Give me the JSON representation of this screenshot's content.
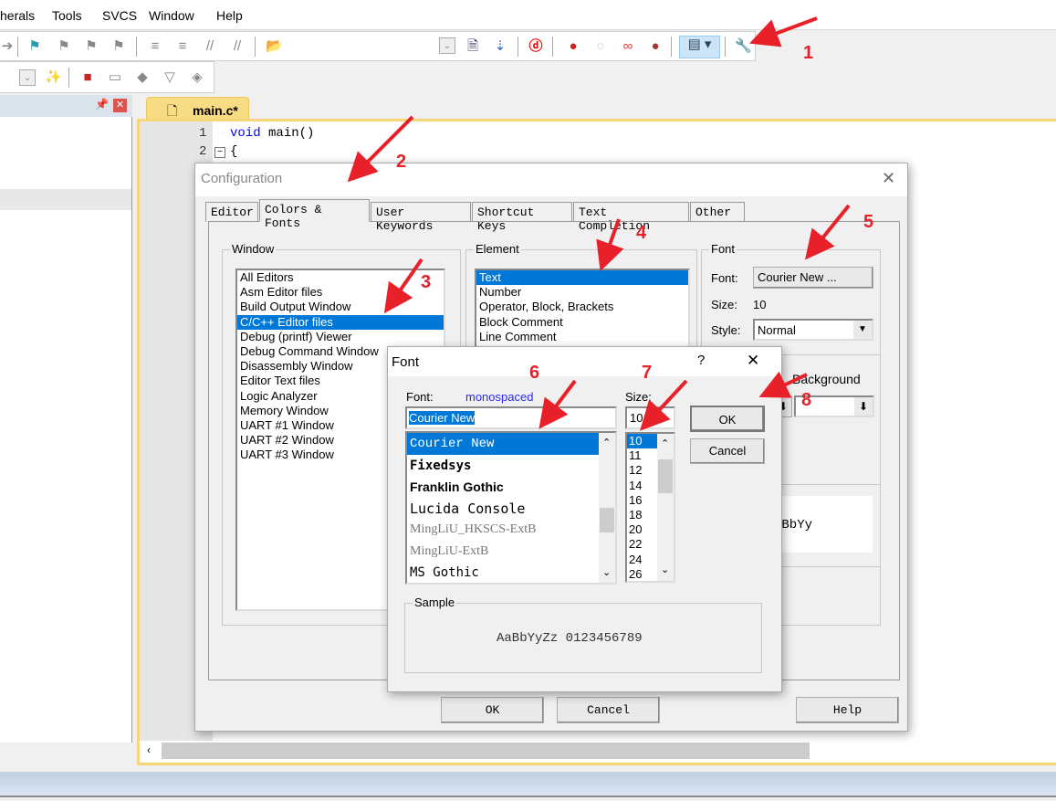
{
  "menu": [
    "herals",
    "Tools",
    "SVCS",
    "Window",
    "Help"
  ],
  "editor": {
    "tab": "main.c*",
    "lines": [
      {
        "num": "1",
        "code": "void main()",
        "keyword": "void",
        "rest": " main()"
      },
      {
        "num": "2",
        "code": "{"
      }
    ]
  },
  "config": {
    "title": "Configuration",
    "tabs": [
      "Editor",
      "Colors & Fonts",
      "User Keywords",
      "Shortcut Keys",
      "Text Completion",
      "Other"
    ],
    "active_tab": "Colors & Fonts",
    "window_group": "Window",
    "window_items": [
      "All Editors",
      "Asm Editor files",
      "Build Output Window",
      "C/C++ Editor files",
      "Debug (printf) Viewer",
      "Debug Command Window",
      "Disassembly Window",
      "Editor Text files",
      "Logic Analyzer",
      "Memory Window",
      "UART #1 Window",
      "UART #2 Window",
      "UART #3 Window"
    ],
    "window_selected": "C/C++ Editor files",
    "element_group": "Element",
    "element_items": [
      "Text",
      "Number",
      "Operator, Block, Brackets",
      "Block Comment",
      "Line Comment"
    ],
    "element_selected": "Text",
    "font_group": "Font",
    "font_label": "Font:",
    "font_button": "Courier New ...",
    "size_label": "Size:",
    "size_value": "10",
    "style_label": "Style:",
    "style_value": "Normal",
    "background_label": "Background",
    "sample_partial": "aBbYy",
    "ok": "OK",
    "cancel": "Cancel",
    "help": "Help"
  },
  "font_dialog": {
    "title": "Font",
    "help": "?",
    "close": "✕",
    "font_label": "Font:",
    "font_hint": "monospaced",
    "font_value": "Courier New",
    "fonts": [
      "Courier New",
      "Fixedsys",
      "Franklin Gothic",
      "Lucida Console",
      "MingLiU_HKSCS-ExtB",
      "MingLiU-ExtB",
      "MS Gothic"
    ],
    "size_label": "Size:",
    "size_value": "10",
    "sizes": [
      "10",
      "11",
      "12",
      "14",
      "16",
      "18",
      "20",
      "22",
      "24",
      "26"
    ],
    "ok": "OK",
    "cancel": "Cancel",
    "sample_label": "Sample",
    "sample_text": "AaBbYyZz 0123456789"
  },
  "annotations": [
    "1",
    "2",
    "3",
    "4",
    "5",
    "6",
    "7",
    "8"
  ],
  "colors": {
    "annotation": "#e8202a",
    "selection": "#0078d7",
    "tab_yellow": "#f5d67a",
    "hint": "#2a2aff"
  }
}
